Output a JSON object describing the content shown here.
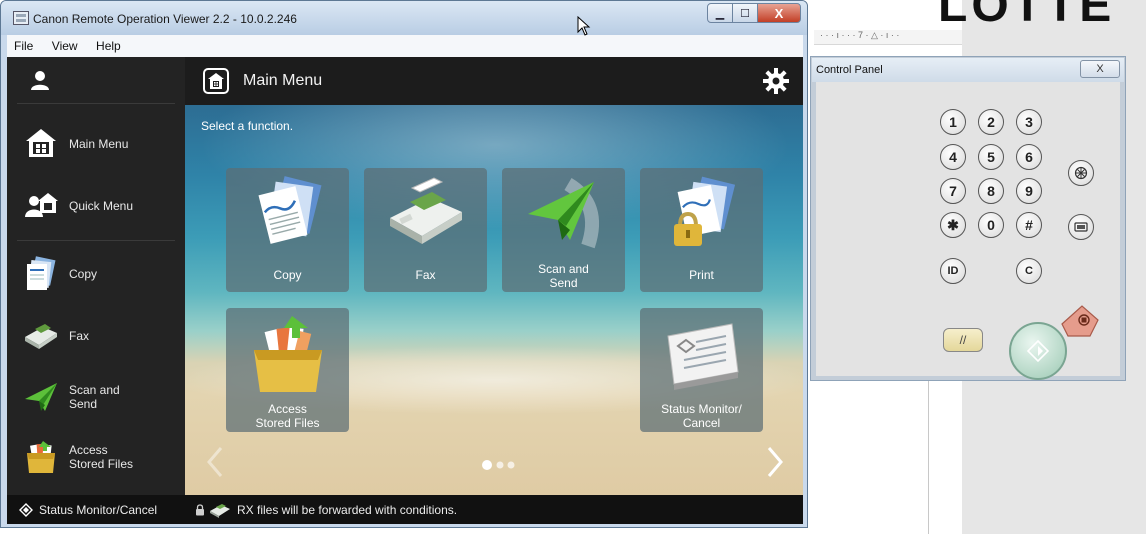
{
  "background_doc": {
    "big_text": "LOTTE",
    "ruler_text": "· · · ı · · · 7 · △ · ı · ·"
  },
  "window": {
    "title": "Canon Remote Operation Viewer 2.2 - 10.0.2.246",
    "controls": {
      "minimize": "▁",
      "maximize": "☐",
      "close": "X"
    }
  },
  "menu": {
    "items": [
      "File",
      "View",
      "Help"
    ]
  },
  "sidebar": {
    "items": [
      {
        "label_line1": "Main Menu",
        "label_line2": "",
        "icon": "home-icon"
      },
      {
        "label_line1": "Quick Menu",
        "label_line2": "",
        "icon": "quick-menu-icon"
      },
      {
        "label_line1": "Copy",
        "label_line2": "",
        "icon": "copy-icon"
      },
      {
        "label_line1": "Fax",
        "label_line2": "",
        "icon": "fax-icon"
      },
      {
        "label_line1": "Scan and",
        "label_line2": "Send",
        "icon": "scan-send-icon"
      },
      {
        "label_line1": "Access",
        "label_line2": "Stored Files",
        "icon": "stored-files-icon"
      }
    ],
    "status_button": "Status Monitor/Cancel"
  },
  "main": {
    "header_title": "Main Menu",
    "instruction": "Select a function.",
    "tiles": [
      {
        "line1": "Copy",
        "line2": ""
      },
      {
        "line1": "Fax",
        "line2": ""
      },
      {
        "line1": "Scan and",
        "line2": "Send"
      },
      {
        "line1": "Print",
        "line2": ""
      },
      {
        "line1": "Access",
        "line2": "Stored Files"
      },
      {
        "line1": "Status Monitor/",
        "line2": "Cancel"
      }
    ],
    "page": {
      "current": 1,
      "total": 3
    },
    "status_message": "RX files will be forwarded with conditions."
  },
  "control_panel": {
    "title": "Control Panel",
    "close": "X",
    "keys": [
      "1",
      "2",
      "3",
      "4",
      "5",
      "6",
      "7",
      "8",
      "9",
      "✱",
      "0",
      "#"
    ],
    "id_key": "ID",
    "c_key": "C",
    "clear_key": "//"
  },
  "colors": {
    "title_bar": "#c9d9ec",
    "sidebar_bg": "#232323",
    "status_bar": "#111111",
    "tile_bg": "#5c6e74",
    "start_button": "#9cc9b3",
    "stop_button": "#e59c8c"
  }
}
